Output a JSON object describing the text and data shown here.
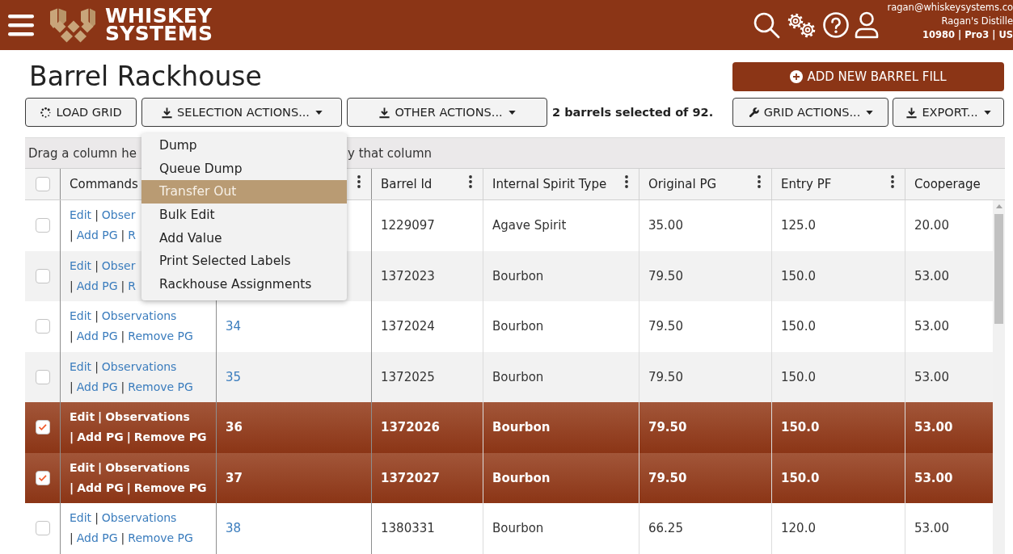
{
  "top_bar": {
    "brand": [
      "WHISKEY",
      "SYSTEMS"
    ],
    "user": {
      "email": "ragan@whiskeysystems.co",
      "company": "Ragan's Distille",
      "account": "10980 | Pro3 | US"
    }
  },
  "page": {
    "title": "Barrel Rackhouse"
  },
  "add_button": {
    "label": "ADD NEW BARREL FILL"
  },
  "toolbar": {
    "left_buttons": [
      {
        "label": "LOAD GRID",
        "dropdown": false
      },
      {
        "label": "SELECTION ACTIONS...",
        "dropdown": true,
        "menu": [
          {
            "label": "Dump",
            "selected": false
          },
          {
            "label": "Queue Dump",
            "selected": false
          },
          {
            "label": "Transfer Out",
            "selected": true
          },
          {
            "label": "Bulk Edit",
            "selected": false
          },
          {
            "label": "Add Value",
            "selected": false
          },
          {
            "label": "Print Selected Labels",
            "selected": false
          },
          {
            "label": "Rackhouse Assignments",
            "selected": false
          }
        ]
      },
      {
        "label": "OTHER ACTIONS...",
        "dropdown": true
      }
    ],
    "selection_summary": "2 barrels selected of 92.",
    "right_buttons": [
      {
        "label": "GRID ACTIONS...",
        "dropdown": true
      },
      {
        "label": "EXPORT...",
        "dropdown": true
      }
    ]
  },
  "grid": {
    "group_hint": {
      "before_menu": "Drag a column he",
      "after_menu": "y that column"
    },
    "header_checked": false,
    "columns": [
      {
        "label": "Commands",
        "menu_icon": false
      },
      {
        "menu_icon": true
      },
      {
        "label": "Barrel Id",
        "menu_icon": true
      },
      {
        "label": "Internal Spirit Type",
        "menu_icon": true
      },
      {
        "label": "Original PG",
        "menu_icon": true
      },
      {
        "label": "Entry PF",
        "menu_icon": true
      },
      {
        "label": "Cooperage",
        "menu_icon": false
      }
    ],
    "rows": [
      {
        "selected": false,
        "commands": [
          [
            {
              "text": "Edit",
              "kind": "link"
            },
            {
              "text": "|",
              "kind": "separator"
            },
            {
              "text": "Obser",
              "kind": "link"
            }
          ],
          [
            {
              "text": "|",
              "kind": "separator"
            },
            {
              "text": "Add PG",
              "kind": "link"
            },
            {
              "text": "|",
              "kind": "separator"
            },
            {
              "text": "R",
              "kind": "link"
            }
          ]
        ],
        "barrel_id": "1229097",
        "spirit_type": "Agave Spirit",
        "original_pg": "35.00",
        "entry_pf": "125.0",
        "cooperage": "20.00"
      },
      {
        "selected": false,
        "commands": [
          [
            {
              "text": "Edit",
              "kind": "link"
            },
            {
              "text": "|",
              "kind": "separator"
            },
            {
              "text": "Obser",
              "kind": "link"
            }
          ],
          [
            {
              "text": "|",
              "kind": "separator"
            },
            {
              "text": "Add PG",
              "kind": "link"
            },
            {
              "text": "|",
              "kind": "separator"
            },
            {
              "text": "R",
              "kind": "link"
            }
          ]
        ],
        "barrel_id": "1372023",
        "spirit_type": "Bourbon",
        "original_pg": "79.50",
        "entry_pf": "150.0",
        "cooperage": "53.00"
      },
      {
        "selected": false,
        "commands": [
          [
            {
              "text": "Edit",
              "kind": "link"
            },
            {
              "text": "|",
              "kind": "separator"
            },
            {
              "text": "Observations",
              "kind": "link"
            }
          ],
          [
            {
              "text": "|",
              "kind": "separator"
            },
            {
              "text": "Add PG",
              "kind": "link"
            },
            {
              "text": "|",
              "kind": "separator"
            },
            {
              "text": "Remove PG",
              "kind": "link"
            }
          ]
        ],
        "column_3": "34",
        "barrel_id": "1372024",
        "spirit_type": "Bourbon",
        "original_pg": "79.50",
        "entry_pf": "150.0",
        "cooperage": "53.00"
      },
      {
        "selected": false,
        "commands": [
          [
            {
              "text": "Edit",
              "kind": "link"
            },
            {
              "text": "|",
              "kind": "separator"
            },
            {
              "text": "Observations",
              "kind": "link"
            }
          ],
          [
            {
              "text": "|",
              "kind": "separator"
            },
            {
              "text": "Add PG",
              "kind": "link"
            },
            {
              "text": "|",
              "kind": "separator"
            },
            {
              "text": "Remove PG",
              "kind": "link"
            }
          ]
        ],
        "column_3": "35",
        "barrel_id": "1372025",
        "spirit_type": "Bourbon",
        "original_pg": "79.50",
        "entry_pf": "150.0",
        "cooperage": "53.00"
      },
      {
        "selected": true,
        "commands": [
          [
            {
              "text": "Edit",
              "kind": "link"
            },
            {
              "text": "|",
              "kind": "separator"
            },
            {
              "text": "Observations",
              "kind": "link"
            }
          ],
          [
            {
              "text": "|",
              "kind": "separator"
            },
            {
              "text": "Add PG",
              "kind": "link"
            },
            {
              "text": "|",
              "kind": "separator"
            },
            {
              "text": "Remove PG",
              "kind": "link"
            }
          ]
        ],
        "column_3": "36",
        "barrel_id": "1372026",
        "spirit_type": "Bourbon",
        "original_pg": "79.50",
        "entry_pf": "150.0",
        "cooperage": "53.00"
      },
      {
        "selected": true,
        "commands": [
          [
            {
              "text": "Edit",
              "kind": "link"
            },
            {
              "text": "|",
              "kind": "separator"
            },
            {
              "text": "Observations",
              "kind": "link"
            }
          ],
          [
            {
              "text": "|",
              "kind": "separator"
            },
            {
              "text": "Add PG",
              "kind": "link"
            },
            {
              "text": "|",
              "kind": "separator"
            },
            {
              "text": "Remove PG",
              "kind": "link"
            }
          ]
        ],
        "column_3": "37",
        "barrel_id": "1372027",
        "spirit_type": "Bourbon",
        "original_pg": "79.50",
        "entry_pf": "150.0",
        "cooperage": "53.00"
      },
      {
        "selected": false,
        "commands": [
          [
            {
              "text": "Edit",
              "kind": "link"
            },
            {
              "text": "|",
              "kind": "separator"
            },
            {
              "text": "Observations",
              "kind": "link"
            }
          ],
          [
            {
              "text": "|",
              "kind": "separator"
            },
            {
              "text": "Add PG",
              "kind": "link"
            },
            {
              "text": "|",
              "kind": "separator"
            },
            {
              "text": "Remove PG",
              "kind": "link"
            }
          ]
        ],
        "column_3": "38",
        "barrel_id": "1380331",
        "spirit_type": "Bourbon",
        "original_pg": "66.25",
        "entry_pf": "120.0",
        "cooperage": "53.00"
      }
    ]
  }
}
